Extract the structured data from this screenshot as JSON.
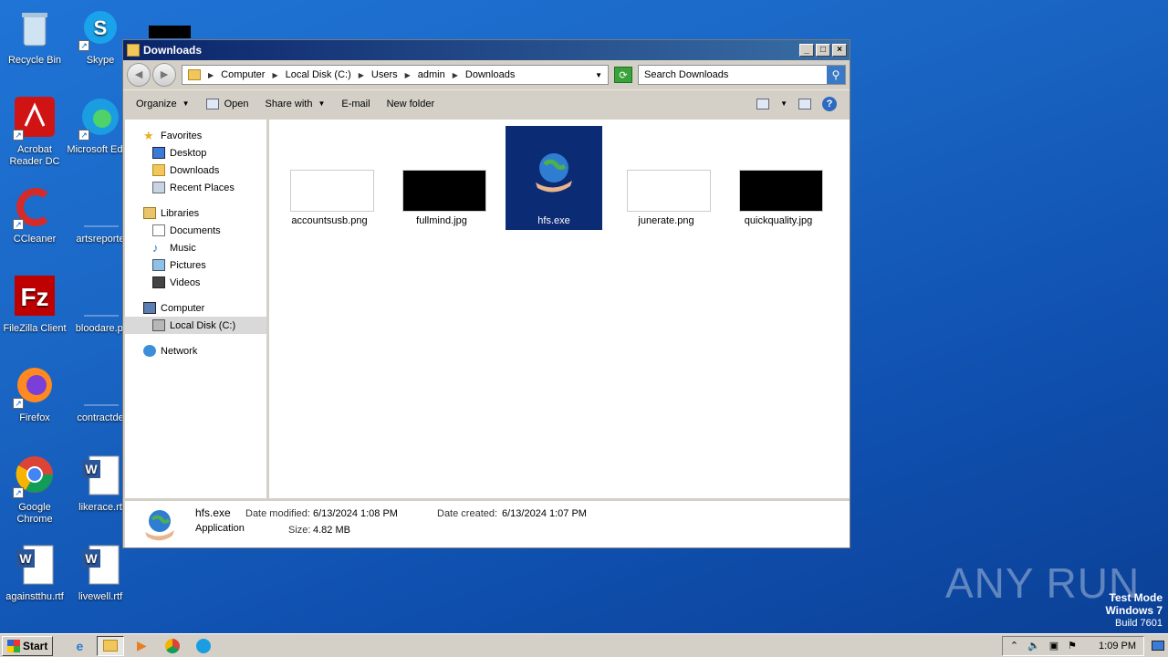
{
  "desktop_icons": [
    {
      "label": "Recycle Bin",
      "icon": "recycle-bin-icon"
    },
    {
      "label": "Skype",
      "icon": "skype-icon"
    },
    {
      "label": "Acrobat Reader DC",
      "icon": "acrobat-icon"
    },
    {
      "label": "Microsoft Edge",
      "icon": "edge-icon"
    },
    {
      "label": "CCleaner",
      "icon": "ccleaner-icon"
    },
    {
      "label": "artsreporte",
      "icon": "file-icon"
    },
    {
      "label": "FileZilla Client",
      "icon": "filezilla-icon"
    },
    {
      "label": "bloodare.pi",
      "icon": "file-icon"
    },
    {
      "label": "Firefox",
      "icon": "firefox-icon"
    },
    {
      "label": "contractde",
      "icon": "file-icon"
    },
    {
      "label": "Google Chrome",
      "icon": "chrome-icon"
    },
    {
      "label": "likerace.rt",
      "icon": "word-icon"
    },
    {
      "label": "againstthu.rtf",
      "icon": "word-icon"
    },
    {
      "label": "livewell.rtf",
      "icon": "word-icon"
    }
  ],
  "window": {
    "title": "Downloads",
    "address": {
      "crumbs": [
        "Computer",
        "Local Disk (C:)",
        "Users",
        "admin",
        "Downloads"
      ]
    },
    "search_placeholder": "Search Downloads",
    "toolbar": {
      "organize": "Organize",
      "open": "Open",
      "share_with": "Share with",
      "email": "E-mail",
      "new_folder": "New folder"
    }
  },
  "navpane": {
    "favorites": "Favorites",
    "desktop": "Desktop",
    "downloads": "Downloads",
    "recent": "Recent Places",
    "libraries": "Libraries",
    "documents": "Documents",
    "music": "Music",
    "pictures": "Pictures",
    "videos": "Videos",
    "computer": "Computer",
    "local_disk": "Local Disk (C:)",
    "network": "Network"
  },
  "files": [
    {
      "name": "accountsusb.png",
      "thumb": "#ffffff"
    },
    {
      "name": "fullmind.jpg",
      "thumb": "#000000"
    },
    {
      "name": "hfs.exe",
      "thumb": "#0c2b75"
    },
    {
      "name": "junerate.png",
      "thumb": "#ffffff"
    },
    {
      "name": "quickquality.jpg",
      "thumb": "#000000"
    }
  ],
  "details": {
    "name": "hfs.exe",
    "type": "Application",
    "modified_label": "Date modified:",
    "modified": "6/13/2024 1:08 PM",
    "size_label": "Size:",
    "size": "4.82 MB",
    "created_label": "Date created:",
    "created": "6/13/2024 1:07 PM"
  },
  "taskbar": {
    "start": "Start",
    "clock": "1:09 PM"
  },
  "watermark": "ANY RUN",
  "testmode": {
    "line1": "Test Mode",
    "line2": "Windows 7",
    "line3": "Build 7601"
  }
}
